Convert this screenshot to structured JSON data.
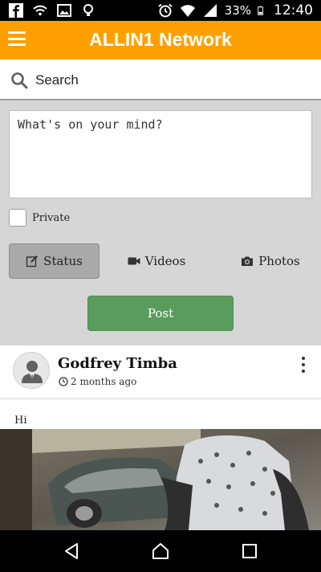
{
  "status_bar": {
    "battery": "33%",
    "time": "12:40",
    "left_icons": [
      "facebook-icon",
      "wifi-icon",
      "image-icon",
      "lightbulb-icon"
    ],
    "right_icons": [
      "alarm-icon",
      "wifi-icon",
      "signal-icon",
      "battery-icon"
    ]
  },
  "app_bar": {
    "title": "ALLIN1 Network",
    "background": "#FFA000",
    "menu_icon": "hamburger-icon"
  },
  "search": {
    "label": "Search",
    "icon": "search-icon"
  },
  "composer": {
    "placeholder": "What's on your mind?",
    "private_label": "Private",
    "private_checked": false,
    "tabs": [
      {
        "label": "Status",
        "icon": "edit-icon",
        "selected": true
      },
      {
        "label": "Videos",
        "icon": "video-camera-icon",
        "selected": false
      },
      {
        "label": "Photos",
        "icon": "camera-icon",
        "selected": false
      }
    ],
    "post_label": "Post",
    "post_color": "#5a9c5e"
  },
  "feed": {
    "post": {
      "author": "Godfrey Timba",
      "time": "2 months ago",
      "text": "Hi",
      "avatar_icon": "user-avatar-icon",
      "menu_icon": "more-vertical-icon"
    }
  },
  "nav_bar": {
    "buttons": [
      "back-icon",
      "home-icon",
      "recents-icon"
    ]
  }
}
